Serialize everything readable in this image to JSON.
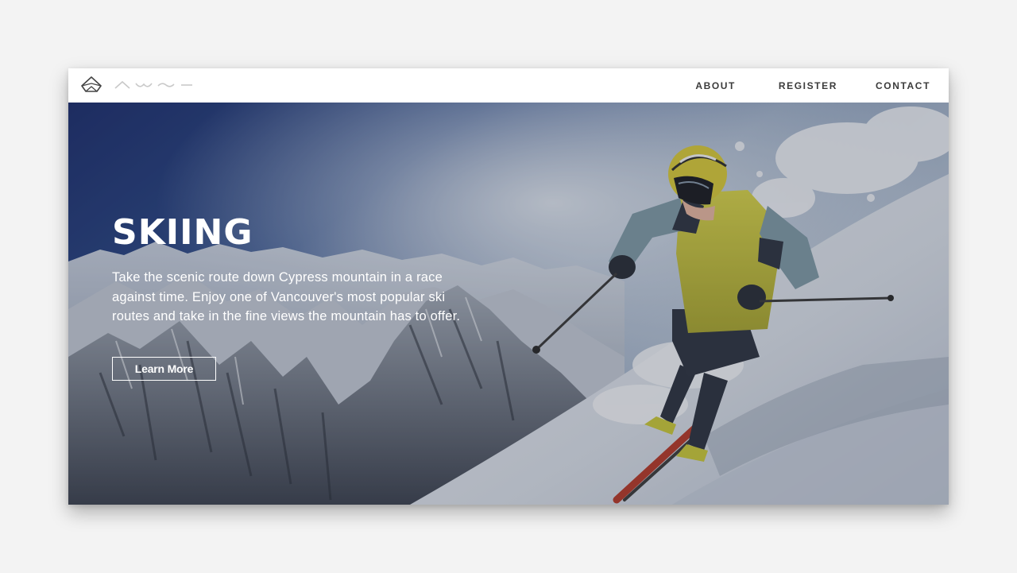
{
  "nav": {
    "links": [
      {
        "label": "ABOUT"
      },
      {
        "label": "REGISTER"
      },
      {
        "label": "CONTACT"
      }
    ]
  },
  "hero": {
    "title": "SKIING",
    "description": "Take the scenic route down Cypress mountain in a race against time. Enjoy one of Vancouver's most popular ski routes and take in the fine views the mountain has to offer.",
    "button_label": "Learn More",
    "image": "skier-on-snowy-mountain-slope"
  },
  "icons": {
    "logo": "diamond-mountain-logo-icon",
    "waves": [
      "peak-icon",
      "wave-icon",
      "tilde-icon",
      "dash-icon"
    ]
  },
  "colors": {
    "page_background": "#f3f3f3",
    "nav_background": "#ffffff",
    "nav_text": "#3b3b3b",
    "hero_text": "#ffffff",
    "jacket": "#c9c83a"
  }
}
